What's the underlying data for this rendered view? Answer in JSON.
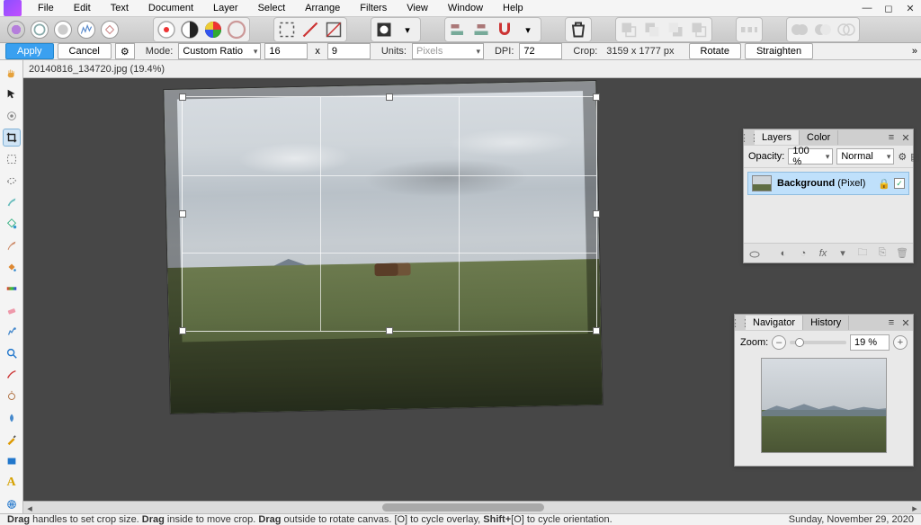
{
  "menu": {
    "items": [
      "File",
      "Edit",
      "Text",
      "Document",
      "Layer",
      "Select",
      "Arrange",
      "Filters",
      "View",
      "Window",
      "Help"
    ]
  },
  "options": {
    "apply": "Apply",
    "cancel": "Cancel",
    "mode_label": "Mode:",
    "mode_value": "Custom Ratio",
    "ratio_w": "16",
    "ratio_h": "9",
    "units_label": "Units:",
    "units_value": "Pixels",
    "dpi_label": "DPI:",
    "dpi_value": "72",
    "crop_label": "Crop:",
    "crop_value": "3159 x 1777 px",
    "rotate": "Rotate",
    "straighten": "Straighten"
  },
  "document": {
    "tab": "20140816_134720.jpg (19.4%)"
  },
  "layers": {
    "tab_layers": "Layers",
    "tab_colour": "Color",
    "opacity_label": "Opacity:",
    "opacity_value": "100 %",
    "blend_value": "Normal",
    "background_name": "Background",
    "background_type": "(Pixel)"
  },
  "navigator": {
    "tab_nav": "Navigator",
    "tab_history": "History",
    "zoom_label": "Zoom:",
    "zoom_value": "19 %"
  },
  "status": {
    "drag1": "Drag",
    "t1": " handles to set crop size. ",
    "drag2": "Drag",
    "t2": " inside to move crop. ",
    "drag3": "Drag",
    "t3": " outside to rotate canvas. [O] to cycle overlay, ",
    "shift": "Shift+",
    "t4": "[O] to cycle orientation.",
    "date": "Sunday, November 29, 2020"
  }
}
